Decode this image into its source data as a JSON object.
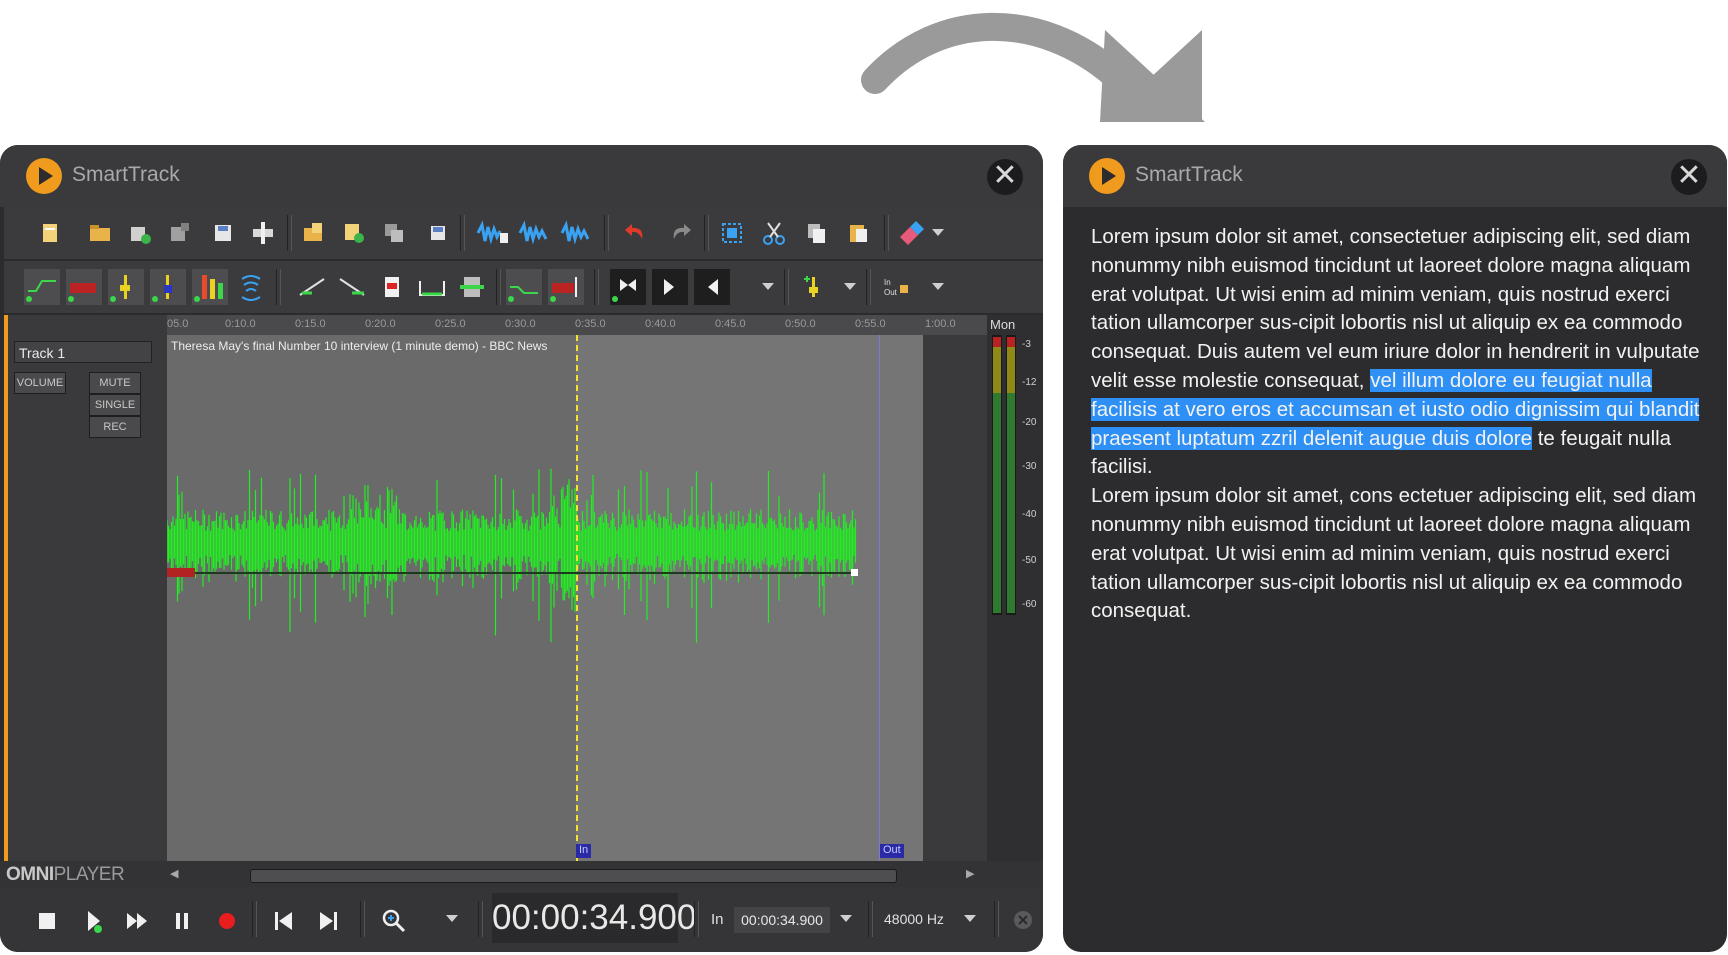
{
  "left_window": {
    "title": "SmartTrack",
    "close_glyph": "✕",
    "ruler_ticks": [
      "05.0",
      "0:10.0",
      "0:15.0",
      "0:20.0",
      "0:25.0",
      "0:30.0",
      "0:35.0",
      "0:40.0",
      "0:45.0",
      "0:50.0",
      "0:55.0",
      "1:00.0"
    ],
    "track": {
      "name": "Track 1",
      "volume_label": "VOLUME",
      "mute_label": "MUTE",
      "single_label": "SINGLE",
      "rec_label": "REC"
    },
    "clip_title": "Theresa May's final Number 10 interview (1 minute demo) - BBC News",
    "monitor_label": "Mon",
    "meter_scale": [
      "-3",
      "-12",
      "-20",
      "-30",
      "-40",
      "-50",
      "-60"
    ],
    "in_marker": "In",
    "out_marker": "Out",
    "brand_bold": "OMNI",
    "brand_thin": "PLAYER",
    "timecode": "00:00:34.900",
    "in_label": "In",
    "in_value": "00:00:34.900",
    "sample_rate": "48000 Hz",
    "colors": {
      "accent": "#f09a1e",
      "waveform": "#22ee22",
      "playhead": "#f4e22e",
      "marker": "#2a2aa6"
    }
  },
  "right_window": {
    "title": "SmartTrack",
    "close_glyph": "✕",
    "text_before": "Lorem ipsum dolor sit amet, consectetuer adipiscing elit, sed diam nonummy nibh euismod tincidunt ut laoreet dolore magna aliquam erat volutpat. Ut wisi enim ad minim veniam, quis nostrud exerci tation ullamcorper sus-cipit lobortis nisl ut aliquip ex ea commodo consequat. Duis autem vel eum iriure dolor in hendrerit in vulputate velit esse molestie consequat, ",
    "text_selected": "vel illum dolore eu feugiat nulla facilisis at vero eros et accumsan et iusto odio dignissim qui blandit praesent luptatum zzril delenit augue duis dolore",
    "text_after": " te feugait nulla facilisi.",
    "text_paragraph2": "Lorem ipsum dolor sit amet, cons ectetuer adipiscing elit, sed diam nonummy nibh euismod tincidunt ut laoreet dolore magna aliquam erat volutpat. Ut wisi enim ad minim veniam, quis nostrud exerci tation ullamcorper sus-cipit lobortis nisl ut aliquip ex ea commodo consequat.",
    "colors": {
      "selection": "#2e8ff5"
    }
  }
}
